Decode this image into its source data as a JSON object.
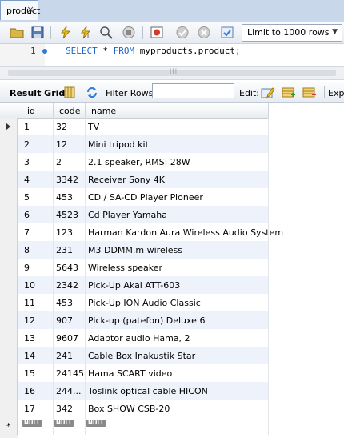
{
  "tab": {
    "title": "product",
    "close": "×"
  },
  "toolbar": {
    "icons": [
      "folder-open-icon",
      "save-icon",
      "execute-icon",
      "execute-current-icon",
      "explain-icon",
      "stop-icon",
      "toggle-error-icon",
      "commit-icon",
      "rollback-icon",
      "autocommit-icon"
    ],
    "limit_label": "Limit to 1000 rows",
    "limit_arrow": "▼"
  },
  "editor": {
    "line_number": "1",
    "sql_keyword_1": "SELECT",
    "sql_star": " * ",
    "sql_keyword_2": "FROM",
    "sql_rest": " myproducts.product;"
  },
  "result_toolbar": {
    "result_grid_label": "Result Grid",
    "filter_label": "Filter Rows:",
    "filter_value": "",
    "edit_label": "Edit:",
    "export_label": "Expo"
  },
  "grid": {
    "columns": [
      "id",
      "code",
      "name"
    ],
    "rows": [
      {
        "id": "1",
        "code": "32",
        "name": "TV"
      },
      {
        "id": "2",
        "code": "12",
        "name": "Mini tripod kit"
      },
      {
        "id": "3",
        "code": "2",
        "name": "2.1 speaker, RMS: 28W"
      },
      {
        "id": "4",
        "code": "3342",
        "name": "Receiver Sony 4K"
      },
      {
        "id": "5",
        "code": "453",
        "name": "CD / SA-CD Player Pioneer"
      },
      {
        "id": "6",
        "code": "4523",
        "name": "Cd Player Yamaha"
      },
      {
        "id": "7",
        "code": "123",
        "name": "Harman Kardon Aura Wireless Audio System"
      },
      {
        "id": "8",
        "code": "231",
        "name": "M3 DDMM.m wireless"
      },
      {
        "id": "9",
        "code": "5643",
        "name": "Wireless speaker"
      },
      {
        "id": "10",
        "code": "2342",
        "name": "Pick-Up Akai ATT-603"
      },
      {
        "id": "11",
        "code": "453",
        "name": "Pick-Up ION Audio Classic"
      },
      {
        "id": "12",
        "code": "907",
        "name": "Pick-up (patefon) Deluxe 6"
      },
      {
        "id": "13",
        "code": "9607",
        "name": "Adaptor audio Hama, 2"
      },
      {
        "id": "14",
        "code": "241",
        "name": "Cable Box Inakustik Star"
      },
      {
        "id": "15",
        "code": "24145",
        "name": "Hama SCART video"
      },
      {
        "id": "16",
        "code": "244...",
        "name": "Toslink optical cable HICON"
      },
      {
        "id": "17",
        "code": "342",
        "name": "Box SHOW CSB-20"
      }
    ],
    "new_row_marker": "*",
    "null_label": "NULL"
  }
}
